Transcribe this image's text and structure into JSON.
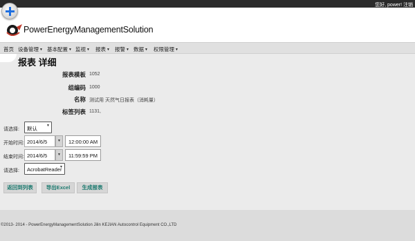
{
  "topbar": {
    "user_text": "您好, power! 注销"
  },
  "header": {
    "brand": "PowerEnergyManagementSolution"
  },
  "nav": {
    "home": "首页",
    "device_manage": "设备管理",
    "basic_config": "基本配置",
    "monitor": "监视",
    "report": "报表",
    "alarm": "报警",
    "data": "数据",
    "permission_manage": "权限管理"
  },
  "page": {
    "title": "报表 详细"
  },
  "details": {
    "template_label": "报表模板",
    "template_value": "1052",
    "group_code_label": "组编码",
    "group_code_value": "1000",
    "name_label": "名称",
    "name_value": "测试用 天然气日报表（消耗量）",
    "tag_list_label": "标签列表",
    "tag_list_value": "1131,"
  },
  "form": {
    "select_label_1": "请选择:",
    "select_value_1": "默认",
    "start_label": "开始时间:",
    "start_date": "2014/6/5",
    "start_time": "12:00:00 AM",
    "end_label": "结束时间:",
    "end_date": "2014/6/5",
    "end_time": "11:59:59 PM",
    "select_label_2": "请选择:",
    "select_value_2": "AcrobatReader"
  },
  "buttons": {
    "back_to_list": "返回到列表",
    "export_excel": "导出Excel",
    "generate_report": "生成报表"
  },
  "footer": {
    "copyright": "©2013- 2014 - PowerEnergyManagementSolution Jilin KEJIAN Autocontrol Equipment CO.,LTD"
  }
}
